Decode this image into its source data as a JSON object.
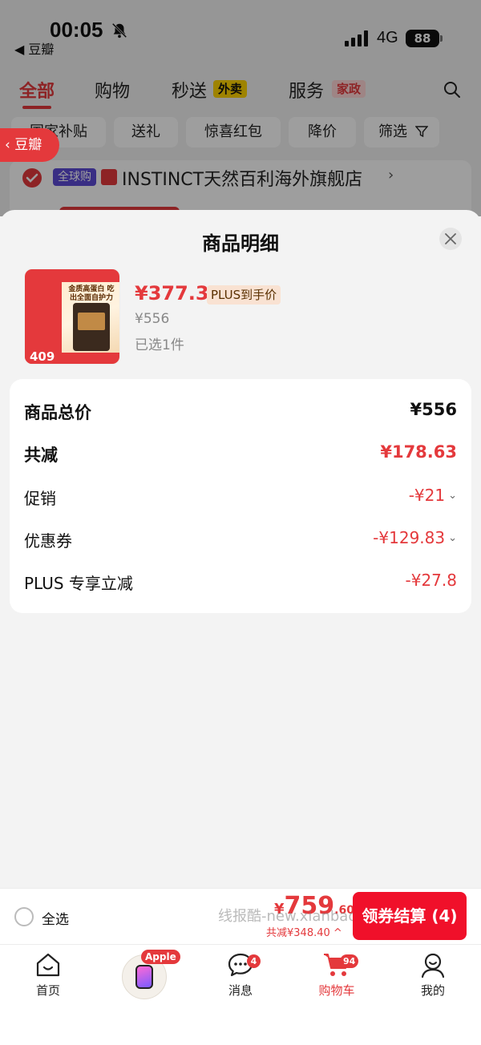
{
  "status_bar": {
    "time": "00:05",
    "back_app": "◀ 豆瓣",
    "network": "4G",
    "battery": "88"
  },
  "top_nav": {
    "tabs": [
      {
        "label": "全部",
        "active": true
      },
      {
        "label": "购物"
      },
      {
        "label": "秒送",
        "badge": "外卖"
      },
      {
        "label": "服务",
        "badge": "家政"
      }
    ]
  },
  "filter_chips": [
    "国家补贴",
    "送礼",
    "惊喜红包",
    "降价",
    "筛选"
  ],
  "douban_pill": "豆瓣",
  "store": {
    "tag": "全球购",
    "name": "INSTINCT天然百利海外旗舰店",
    "chevron": "›"
  },
  "sheet": {
    "title": "商品明细",
    "product": {
      "price": "¥377.37",
      "price_tag": "PLUS到手价",
      "original_price": "¥556",
      "selected": "已选1件",
      "thumb_headline": "金质高蛋白 吃出全面自护力",
      "thumb_price": "409"
    },
    "rows": [
      {
        "label": "商品总价",
        "value": "¥556"
      },
      {
        "label": "共减",
        "value": "¥178.63"
      },
      {
        "label": "促销",
        "value": "-¥21"
      },
      {
        "label": "优惠券",
        "value": "-¥129.83"
      },
      {
        "label": "PLUS 专享立减",
        "value": "-¥27.8"
      }
    ]
  },
  "bottom_bar": {
    "select_all": "全选",
    "total_symbol": "¥",
    "total_int": "759",
    "total_dec": ".60",
    "discount": "共减¥348.40 ^",
    "watermark": "线报酷-new.xianbao.fun",
    "checkout": "领券结算 (4)"
  },
  "tab_bar": {
    "items": [
      {
        "label": "首页"
      },
      {
        "label": "Apple",
        "badge": "Apple"
      },
      {
        "label": "消息",
        "badge": "4"
      },
      {
        "label": "购物车",
        "badge": "94",
        "active": true
      },
      {
        "label": "我的"
      }
    ]
  },
  "colors": {
    "accent": "#e4393c",
    "checkout": "#f0102a"
  }
}
